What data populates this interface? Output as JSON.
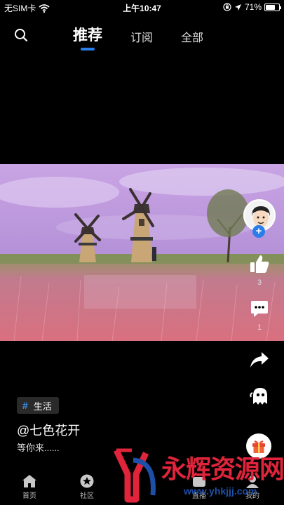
{
  "status_bar": {
    "carrier": "无SIM卡",
    "time": "上午10:47",
    "battery": "71%",
    "battery_level": 0.71
  },
  "top_nav": {
    "tabs": [
      {
        "label": "推荐",
        "active": true
      },
      {
        "label": "订阅",
        "active": false
      },
      {
        "label": "全部",
        "active": false
      }
    ]
  },
  "actions": {
    "like_count": "3",
    "comment_count": "1"
  },
  "post": {
    "tag_symbol": "#",
    "tag": "生活",
    "author": "@七色花开",
    "description": "等你来......"
  },
  "bottom_nav": {
    "items": [
      {
        "label": "首页"
      },
      {
        "label": "社区"
      },
      {
        "label": "直播"
      },
      {
        "label": "我的"
      }
    ]
  },
  "watermark": {
    "text": "永辉资源网",
    "url": "www.yhkjjj.com"
  },
  "colors": {
    "accent": "#2b7de9",
    "watermark_red": "#e0243b",
    "watermark_blue": "#1e4fa8"
  }
}
